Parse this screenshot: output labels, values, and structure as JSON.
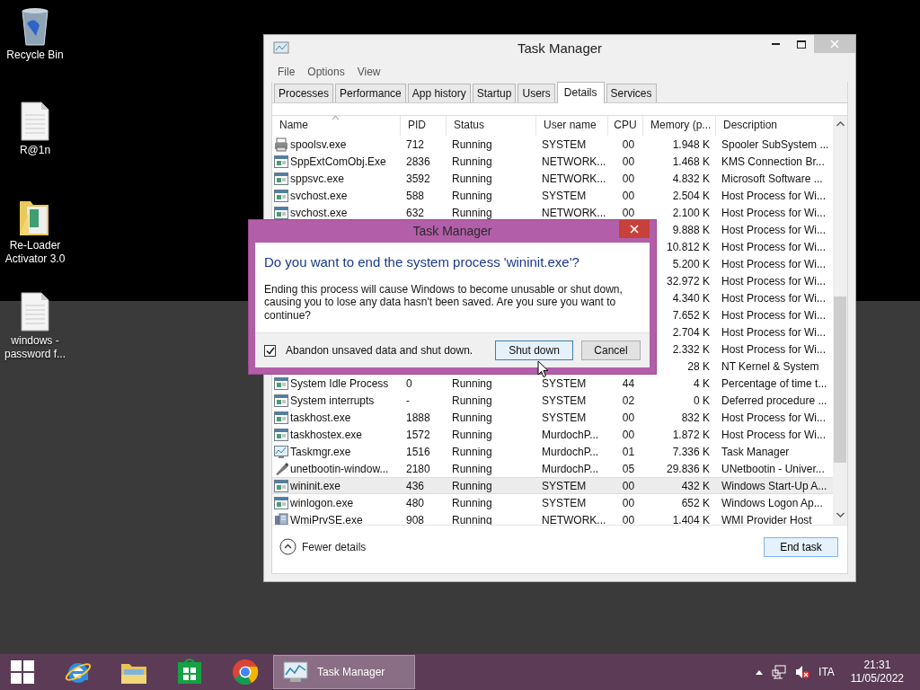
{
  "desktop_icons": [
    {
      "kind": "recycle-bin",
      "label": "Recycle Bin"
    },
    {
      "kind": "document",
      "label": "R@1n"
    },
    {
      "kind": "folder",
      "label": "Re-Loader Activator 3.0"
    },
    {
      "kind": "document",
      "label": "windows - password f..."
    }
  ],
  "window": {
    "title": "Task Manager",
    "menu": [
      "File",
      "Options",
      "View"
    ],
    "tabs": [
      {
        "label": "Processes",
        "selected": false
      },
      {
        "label": "Performance",
        "selected": false
      },
      {
        "label": "App history",
        "selected": false
      },
      {
        "label": "Startup",
        "selected": false
      },
      {
        "label": "Users",
        "selected": false
      },
      {
        "label": "Details",
        "selected": true
      },
      {
        "label": "Services",
        "selected": false
      }
    ],
    "table": {
      "columns": [
        "Name",
        "PID",
        "Status",
        "User name",
        "CPU",
        "Memory (p...",
        "Description"
      ],
      "rows": [
        {
          "kind": "printer",
          "name": "spoolsv.exe",
          "pid": "712",
          "status": "Running",
          "user": "SYSTEM",
          "cpu": "00",
          "memory": "1.948 K",
          "description": "Spooler SubSystem ...",
          "selected": false
        },
        {
          "kind": "app",
          "name": "SppExtComObj.Exe",
          "pid": "2836",
          "status": "Running",
          "user": "NETWORK...",
          "cpu": "00",
          "memory": "1.468 K",
          "description": "KMS Connection Br...",
          "selected": false
        },
        {
          "kind": "app",
          "name": "sppsvc.exe",
          "pid": "3592",
          "status": "Running",
          "user": "NETWORK...",
          "cpu": "00",
          "memory": "4.832 K",
          "description": "Microsoft Software ...",
          "selected": false
        },
        {
          "kind": "app",
          "name": "svchost.exe",
          "pid": "588",
          "status": "Running",
          "user": "SYSTEM",
          "cpu": "00",
          "memory": "2.504 K",
          "description": "Host Process for Wi...",
          "selected": false
        },
        {
          "kind": "app",
          "name": "svchost.exe",
          "pid": "632",
          "status": "Running",
          "user": "NETWORK...",
          "cpu": "00",
          "memory": "2.100 K",
          "description": "Host Process for Wi...",
          "selected": false
        },
        {
          "memory": "9.888 K",
          "description": "Host Process for Wi...",
          "selected": false
        },
        {
          "memory": "10.812 K",
          "description": "Host Process for Wi...",
          "selected": false
        },
        {
          "memory": "5.200 K",
          "description": "Host Process for Wi...",
          "selected": false
        },
        {
          "memory": "32.972 K",
          "description": "Host Process for Wi...",
          "selected": false
        },
        {
          "memory": "4.340 K",
          "description": "Host Process for Wi...",
          "selected": false
        },
        {
          "memory": "7.652 K",
          "description": "Host Process for Wi...",
          "selected": false
        },
        {
          "memory": "2.704 K",
          "description": "Host Process for Wi...",
          "selected": false
        },
        {
          "memory": "2.332 K",
          "description": "Host Process for Wi...",
          "selected": false
        },
        {
          "memory": "28 K",
          "description": "NT Kernel & System",
          "selected": false
        },
        {
          "kind": "app",
          "name": "System Idle Process",
          "pid": "0",
          "status": "Running",
          "user": "SYSTEM",
          "cpu": "44",
          "memory": "4 K",
          "description": "Percentage of time t...",
          "selected": false
        },
        {
          "kind": "app",
          "name": "System interrupts",
          "pid": "-",
          "status": "Running",
          "user": "SYSTEM",
          "cpu": "02",
          "memory": "0 K",
          "description": "Deferred procedure ...",
          "selected": false
        },
        {
          "kind": "app",
          "name": "taskhost.exe",
          "pid": "1888",
          "status": "Running",
          "user": "SYSTEM",
          "cpu": "00",
          "memory": "832 K",
          "description": "Host Process for Wi...",
          "selected": false
        },
        {
          "kind": "app",
          "name": "taskhostex.exe",
          "pid": "1572",
          "status": "Running",
          "user": "MurdochP...",
          "cpu": "00",
          "memory": "1.872 K",
          "description": "Host Process for Wi...",
          "selected": false
        },
        {
          "kind": "monitor",
          "name": "Taskmgr.exe",
          "pid": "1516",
          "status": "Running",
          "user": "MurdochP...",
          "cpu": "01",
          "memory": "7.336 K",
          "description": "Task Manager",
          "selected": false
        },
        {
          "kind": "tool",
          "name": "unetbootin-window...",
          "pid": "2180",
          "status": "Running",
          "user": "MurdochP...",
          "cpu": "05",
          "memory": "29.836 K",
          "description": "UNetbootin - Univer...",
          "selected": false
        },
        {
          "kind": "app",
          "name": "wininit.exe",
          "pid": "436",
          "status": "Running",
          "user": "SYSTEM",
          "cpu": "00",
          "memory": "432 K",
          "description": "Windows Start-Up A...",
          "selected": true
        },
        {
          "kind": "app",
          "name": "winlogon.exe",
          "pid": "480",
          "status": "Running",
          "user": "SYSTEM",
          "cpu": "00",
          "memory": "652 K",
          "description": "Windows Logon Ap...",
          "selected": false
        },
        {
          "kind": "service",
          "name": "WmiPrvSE.exe",
          "pid": "908",
          "status": "Running",
          "user": "NETWORK...",
          "cpu": "00",
          "memory": "1.404 K",
          "description": "WMI Provider Host",
          "selected": false
        }
      ]
    },
    "fewer_details": "Fewer details",
    "end_task": "End task"
  },
  "dialog": {
    "title": "Task Manager",
    "heading": "Do you want to end the system process 'wininit.exe'?",
    "message": "Ending this process will cause Windows to become unusable or shut down, causing you to lose any data hasn't been saved. Are you sure you want to continue?",
    "checkbox": {
      "label": "Abandon unsaved data and shut down.",
      "checked": true
    },
    "buttons": [
      {
        "label": "Shut down",
        "kind": "default"
      },
      {
        "label": "Cancel",
        "kind": "normal"
      }
    ]
  },
  "taskbar": {
    "apps": [
      {
        "kind": "ie",
        "active": false
      },
      {
        "kind": "explorer",
        "active": false
      },
      {
        "kind": "store",
        "active": false
      },
      {
        "kind": "chrome",
        "active": false
      },
      {
        "kind": "taskmgr",
        "label": "Task Manager",
        "active": true
      }
    ],
    "language": "ITA",
    "time": "21:31",
    "date": "11/05/2022"
  }
}
